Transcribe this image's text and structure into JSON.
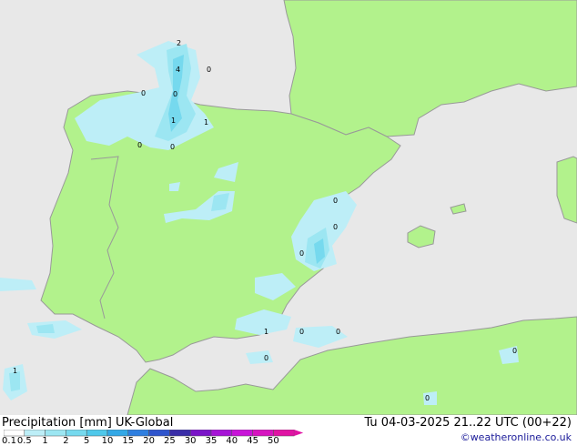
{
  "footer": {
    "product": "Precipitation [mm]  UK-Global",
    "timestamp": "Tu 04-03-2025 21..22 UTC (00+22)",
    "credit": "©weatheronline.co.uk"
  },
  "legend": {
    "ticks": [
      "0.1",
      "0.5",
      "1",
      "2",
      "5",
      "10",
      "15",
      "20",
      "25",
      "30",
      "35",
      "40",
      "45",
      "50"
    ],
    "colors": [
      "#ffffff",
      "#bdeef7",
      "#9ce6f2",
      "#76d9ee",
      "#4fc8ea",
      "#33a8e6",
      "#2f7fe0",
      "#2f55cc",
      "#3a2ea8",
      "#7a14c8",
      "#a614d6",
      "#c814d8",
      "#d614c0",
      "#e014a4"
    ]
  },
  "map_colors": {
    "sea": "#e8e8e8",
    "land": "#b2f28c",
    "border": "#999999",
    "rain_light": "#bdeef7",
    "rain_mid": "#9ce6f2",
    "rain_heavy": "#76d9ee"
  },
  "precip_labels": [
    {
      "text": "2"
    },
    {
      "text": "4"
    },
    {
      "text": "0"
    },
    {
      "text": "0"
    },
    {
      "text": "0"
    },
    {
      "text": "1"
    },
    {
      "text": "1"
    },
    {
      "text": "0"
    },
    {
      "text": "0"
    },
    {
      "text": "0"
    },
    {
      "text": "0"
    },
    {
      "text": "0"
    },
    {
      "text": "1"
    },
    {
      "text": "0"
    },
    {
      "text": "0"
    },
    {
      "text": "0"
    },
    {
      "text": "0"
    },
    {
      "text": "1"
    },
    {
      "text": "0"
    }
  ]
}
